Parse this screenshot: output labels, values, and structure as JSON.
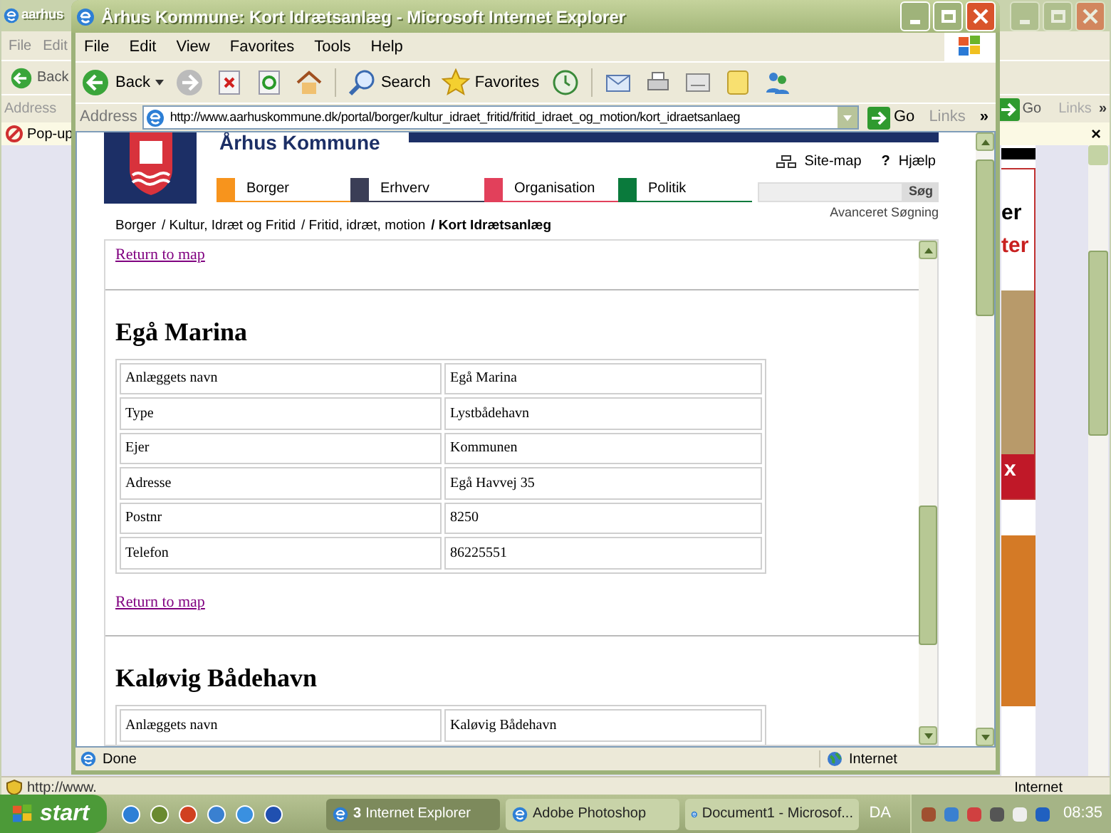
{
  "back_window": {
    "title": "aarhus",
    "menu": [
      "File",
      "Edit"
    ],
    "back": "Back",
    "address_label": "Address",
    "go": "Go",
    "links": "Links",
    "links_chevron": "»",
    "popup_bar": "Pop-up",
    "popup_close": "×",
    "ad_texts": [
      "er",
      "ter",
      "x"
    ],
    "status_url": "http://www.",
    "status_zone": "Internet"
  },
  "window": {
    "title": "Århus Kommune: Kort Idrætsanlæg - Microsoft Internet Explorer",
    "menu": [
      "File",
      "Edit",
      "View",
      "Favorites",
      "Tools",
      "Help"
    ],
    "toolbar": {
      "back": "Back",
      "search": "Search",
      "favorites": "Favorites"
    },
    "address_label": "Address",
    "url": "http://www.aarhuskommune.dk/portal/borger/kultur_idraet_fritid/fritid_idraet_og_motion/kort_idraetsanlaeg",
    "go": "Go",
    "links": "Links",
    "links_chevron": "»"
  },
  "page": {
    "site_name": "Århus Kommune",
    "utility_links": [
      "Site-map",
      "Hjælp"
    ],
    "help_icon": "?",
    "nav": [
      {
        "label": "Borger",
        "color": "#f7941d"
      },
      {
        "label": "Erhverv",
        "color": "#3b3e56"
      },
      {
        "label": "Organisation",
        "color": "#e2405b"
      },
      {
        "label": "Politik",
        "color": "#0a7a3c"
      }
    ],
    "search_button": "Søg",
    "advanced_search": "Avanceret Søgning",
    "breadcrumb": [
      {
        "label": "Borger",
        "current": false
      },
      {
        "label": "/ Kultur, Idræt og Fritid",
        "current": false
      },
      {
        "label": "/ Fritid, idræt, motion",
        "current": false
      },
      {
        "label": "/ Kort Idrætsanlæg",
        "current": true
      }
    ],
    "top_link": "Return to map",
    "facilities": [
      {
        "name": "Egå Marina",
        "rows": [
          {
            "label": "Anlæggets navn",
            "value": "Egå Marina"
          },
          {
            "label": "Type",
            "value": "Lystbådehavn"
          },
          {
            "label": "Ejer",
            "value": "Kommunen"
          },
          {
            "label": "Adresse",
            "value": "Egå Havvej 35"
          },
          {
            "label": "Postnr",
            "value": "8250"
          },
          {
            "label": "Telefon",
            "value": "86225551"
          }
        ],
        "return_link": "Return to map"
      },
      {
        "name": "Kaløvig Bådehavn",
        "rows": [
          {
            "label": "Anlæggets navn",
            "value": "Kaløvig Bådehavn"
          }
        ]
      }
    ]
  },
  "status_bar": {
    "text": "Done",
    "zone": "Internet"
  },
  "taskbar": {
    "start": "start",
    "tasks": [
      {
        "count": "3",
        "label": "Internet Explorer",
        "selected": true
      },
      {
        "label": "Adobe Photoshop",
        "selected": false
      },
      {
        "label": "Document1 - Microsof...",
        "selected": false
      }
    ],
    "language": "DA",
    "clock": "08:35"
  }
}
